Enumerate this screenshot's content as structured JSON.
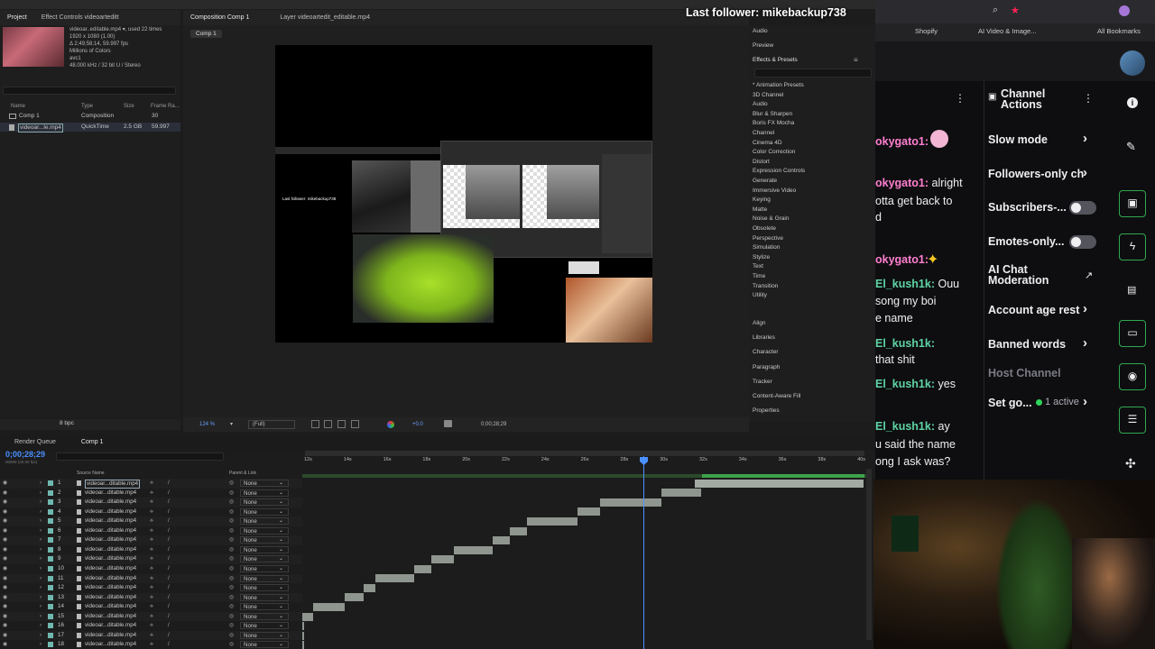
{
  "overlay": {
    "follower": "Last follower: mikebackup738"
  },
  "project": {
    "tabs": [
      "Project",
      "Effect Controls videoarteditt"
    ],
    "file": "videoar..editable.mp4 ▾, used 22 times",
    "res": "1920 x 1080 (1.00)",
    "dur": "Δ 2;49;58;14, 59.997 fps",
    "colors": "Millions of Colors",
    "codec": "avc1",
    "audio": "48.000 kHz / 32 bit U / Stereo",
    "cols": [
      "Name",
      "Type",
      "Size",
      "Frame Ra..."
    ],
    "items": [
      {
        "name": "Comp 1",
        "type": "Composition",
        "size": "",
        "fr": "30"
      },
      {
        "name": "videoar...le.mp4",
        "type": "QuickTime",
        "size": "2.5 GB",
        "fr": "59.997"
      }
    ],
    "bpc": "8 bpc"
  },
  "viewer": {
    "tabs": [
      "Composition Comp 1",
      "Layer videoartedit_editable.mp4"
    ],
    "comp_chip": "Comp 1",
    "follower_small": "Last follower: mikebackup738",
    "zoom": "124 %",
    "quality": "(Full)",
    "timecode": "0;00;28;29",
    "exposure": "+0.0"
  },
  "effects": {
    "top": [
      "Audio",
      "Preview"
    ],
    "title": "Effects & Presets",
    "list": [
      "* Animation Presets",
      "3D Channel",
      "Audio",
      "Blur & Sharpen",
      "Boris FX Mocha",
      "Channel",
      "Cinema 4D",
      "Color Correction",
      "Distort",
      "Expression Controls",
      "Generate",
      "Immersive Video",
      "Keying",
      "Matte",
      "Noise & Grain",
      "Obsolete",
      "Perspective",
      "Simulation",
      "Stylize",
      "Text",
      "Time",
      "Transition",
      "Utility"
    ],
    "panels": [
      "Align",
      "Libraries",
      "Character",
      "Paragraph",
      "Tracker",
      "Content-Aware Fill",
      "Properties"
    ]
  },
  "timeline": {
    "tabs": [
      "Render Queue",
      "Comp 1"
    ],
    "timecode": "0;00;28;29",
    "fps": "00869 (30.00 fps)",
    "col_source": "Source Name",
    "col_parent": "Parent & Link",
    "ticks": [
      "12s",
      "14s",
      "16s",
      "18s",
      "20s",
      "22s",
      "24s",
      "26s",
      "28s",
      "30s",
      "32s",
      "34s",
      "36s",
      "38s",
      "40s"
    ],
    "layer_name": "videoar...ditable.mp4",
    "first_layer": "videoar...ditable.mp4",
    "parent": "None",
    "bars": [
      [
        0.7,
        1.0
      ],
      [
        0.64,
        0.71
      ],
      [
        0.53,
        0.64
      ],
      [
        0.49,
        0.53
      ],
      [
        0.4,
        0.49
      ],
      [
        0.37,
        0.4
      ],
      [
        0.34,
        0.37
      ],
      [
        0.27,
        0.34
      ],
      [
        0.23,
        0.27
      ],
      [
        0.2,
        0.23
      ],
      [
        0.13,
        0.2
      ],
      [
        0.11,
        0.13
      ],
      [
        0.075,
        0.11
      ],
      [
        0.02,
        0.075
      ],
      [
        0.0,
        0.02
      ]
    ]
  },
  "browser": {
    "bookmarks": [
      "Shopify",
      "AI Video & Image...",
      "All Bookmarks"
    ]
  },
  "chat": {
    "lines": [
      {
        "user": "okygato1:",
        "msg": "",
        "ucolor": "#ff7fd0"
      },
      {
        "user": "okygato1:",
        "msg": "alright",
        "ucolor": "#ff7fd0"
      },
      {
        "user": "",
        "msg": "otta get back to"
      },
      {
        "user": "",
        "msg": "d"
      },
      {
        "user": "okygato1:",
        "msg": "",
        "ucolor": "#ff7fd0"
      },
      {
        "user": "El_kush1k:",
        "msg": "Ouu",
        "ucolor": "#5fd3a5"
      },
      {
        "user": "",
        "msg": "song my boi"
      },
      {
        "user": "",
        "msg": "e name"
      },
      {
        "user": "El_kush1k:",
        "msg": "",
        "ucolor": "#5fd3a5"
      },
      {
        "user": "",
        "msg": "that shit"
      },
      {
        "user": "El_kush1k:",
        "msg": "yes",
        "ucolor": "#5fd3a5"
      },
      {
        "user": "El_kush1k:",
        "msg": "ay",
        "ucolor": "#5fd3a5"
      },
      {
        "user": "",
        "msg": "u said the name"
      },
      {
        "user": "",
        "msg": "ong I ask was?"
      }
    ]
  },
  "channel_actions": {
    "title": "Channel Actions",
    "items": [
      "Slow mode",
      "Followers-only ch",
      "Subscribers-...",
      "Emotes-only...",
      "AI Chat Moderation",
      "Account age rest",
      "Banned words",
      "Host Channel",
      "Set go..."
    ],
    "active": "1 active"
  }
}
